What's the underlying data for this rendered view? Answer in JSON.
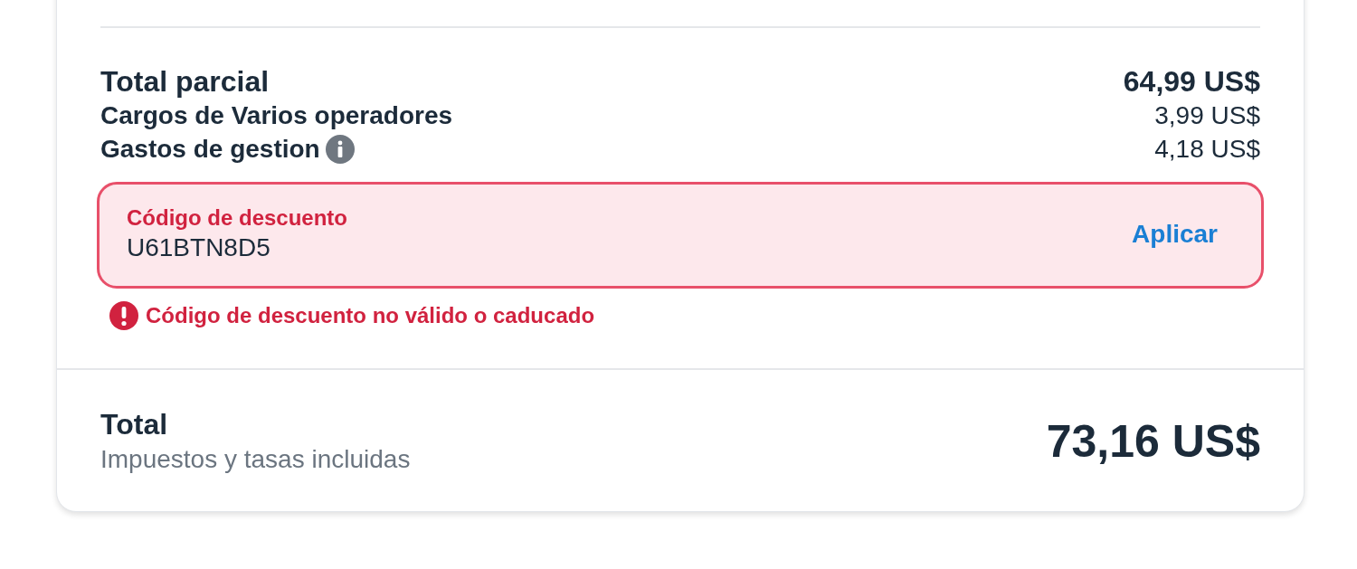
{
  "summary_lines": [
    {
      "label": "Total parcial",
      "amount": "64,99 US$",
      "kind": "subtotal"
    },
    {
      "label": "Cargos de Varios operadores",
      "amount": "3,99 US$",
      "kind": "fee"
    },
    {
      "label": "Gastos de gestion",
      "amount": "4,18 US$",
      "kind": "fee_info"
    }
  ],
  "discount": {
    "label": "Código de descuento",
    "value": "U61BTN8D5",
    "invalid": true,
    "button": "Aplicar",
    "error": "Código de descuento no válido o caducado"
  },
  "total": {
    "label": "Total",
    "note": "Impuestos y tasas incluidas",
    "amount": "73,16 US$"
  }
}
